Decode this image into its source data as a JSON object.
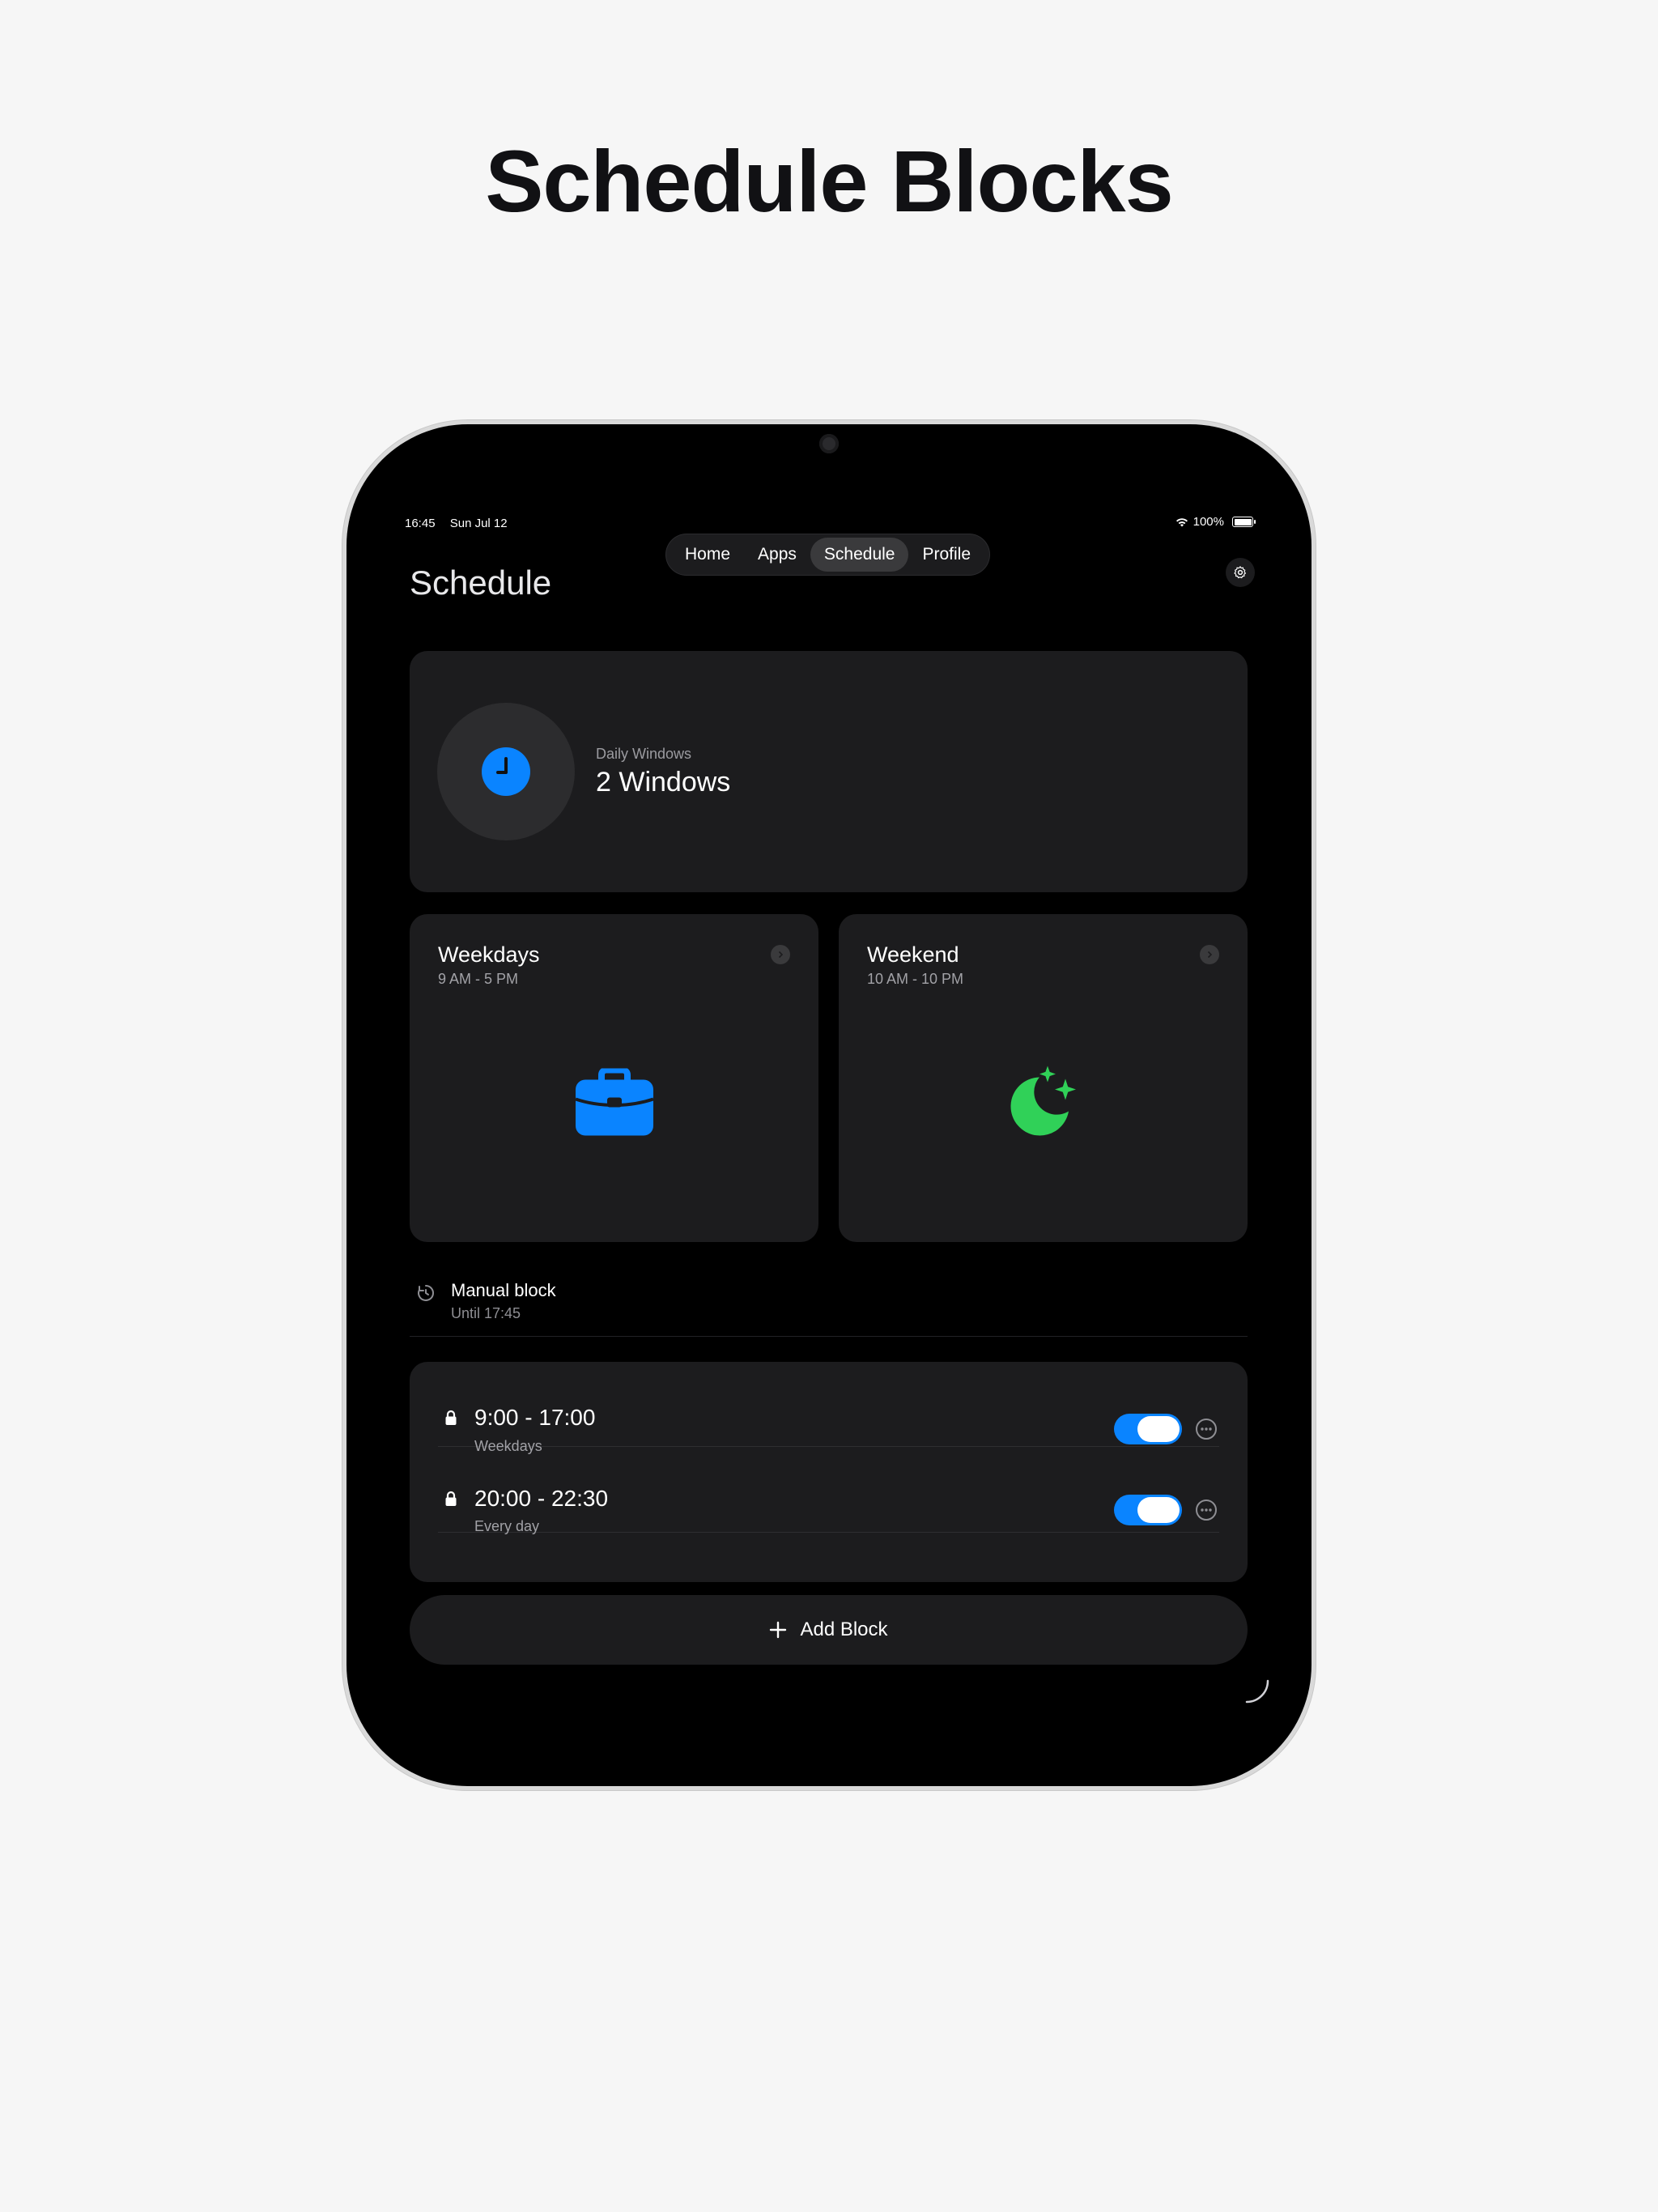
{
  "headline": "Schedule Blocks",
  "status_bar": {
    "time": "16:45",
    "date": "Sun Jul 12",
    "battery": "100%"
  },
  "tabs": [
    {
      "label": "Home"
    },
    {
      "label": "Apps"
    },
    {
      "label": "Schedule",
      "active": true
    },
    {
      "label": "Profile"
    }
  ],
  "page": {
    "title": "Schedule"
  },
  "summary": {
    "kicker": "Daily Windows",
    "value": "2 Windows",
    "icon": "clock-icon",
    "accent": "#0a84ff"
  },
  "tiles": [
    {
      "title": "Weekdays",
      "subtitle": "9 AM - 5 PM",
      "icon": "briefcase-icon",
      "color": "#0a84ff"
    },
    {
      "title": "Weekend",
      "subtitle": "10 AM - 10 PM",
      "icon": "moon-stars-icon",
      "color": "#30d158"
    }
  ],
  "manual": {
    "title": "Manual block",
    "subtitle": "Until 17:45",
    "icon": "timer-icon"
  },
  "blocks": [
    {
      "time": "9:00 - 17:00",
      "days": "Weekdays",
      "enabled": true
    },
    {
      "time": "20:00 - 22:30",
      "days": "Every day",
      "enabled": true
    }
  ],
  "add_button": {
    "label": "Add Block"
  },
  "colors": {
    "background": "#000000",
    "card": "#1c1c1e",
    "accent": "#0a84ff",
    "green": "#30d158"
  }
}
